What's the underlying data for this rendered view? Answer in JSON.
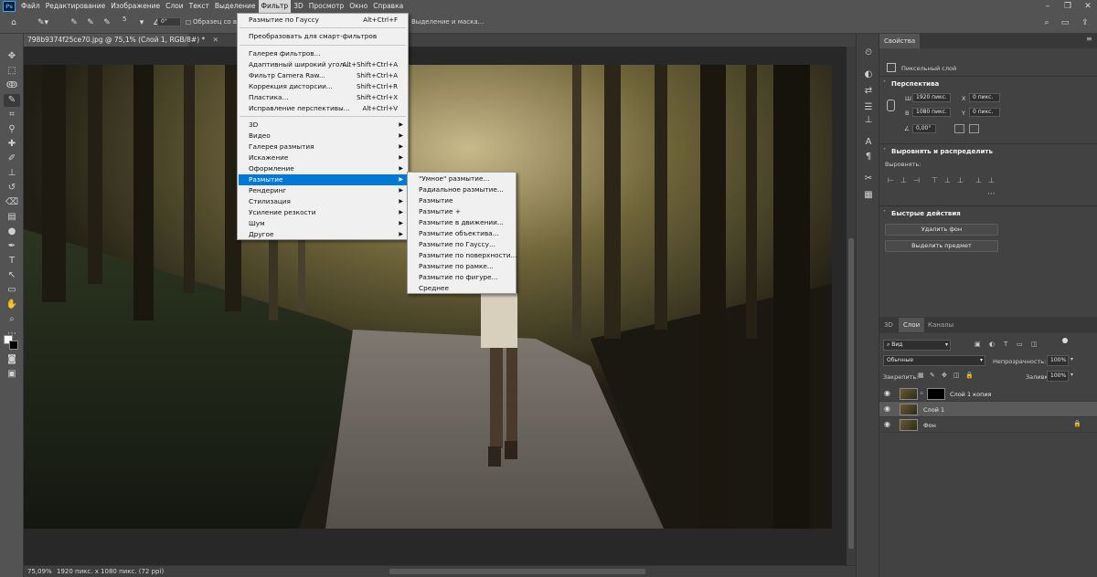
{
  "menubar": {
    "items": [
      "Файл",
      "Редактирование",
      "Изображение",
      "Слои",
      "Текст",
      "Выделение",
      "Фильтр",
      "3D",
      "Просмотр",
      "Окно",
      "Справка"
    ],
    "active": "Фильтр"
  },
  "options_bar": {
    "brush_size": "5",
    "angle": "0°",
    "sample_all_label": "Образец со всех",
    "refine_edge_label": "Выделение и маска..."
  },
  "document": {
    "tab_title": "798b9374f25ce70.jpg @ 75,1% (Слой 1, RGB/8#) *",
    "zoom": "75,09%",
    "doc_size": "1920 пикс. x 1080 пикс. (72 ppi)"
  },
  "filter_menu": {
    "items": [
      {
        "label": "Размытие по Гауссу",
        "shortcut": "Alt+Ctrl+F"
      },
      {
        "label": "Преобразовать для смарт-фильтров",
        "shortcut": ""
      },
      {
        "label": "Галерея фильтров...",
        "shortcut": ""
      },
      {
        "label": "Адаптивный широкий угол...",
        "shortcut": "Alt+Shift+Ctrl+A"
      },
      {
        "label": "Фильтр Camera Raw...",
        "shortcut": "Shift+Ctrl+A"
      },
      {
        "label": "Коррекция дисторсии...",
        "shortcut": "Shift+Ctrl+R"
      },
      {
        "label": "Пластика...",
        "shortcut": "Shift+Ctrl+X"
      },
      {
        "label": "Исправление перспективы...",
        "shortcut": "Alt+Ctrl+V"
      },
      {
        "label": "3D",
        "shortcut": ""
      },
      {
        "label": "Видео",
        "shortcut": ""
      },
      {
        "label": "Галерея размытия",
        "shortcut": ""
      },
      {
        "label": "Искажение",
        "shortcut": ""
      },
      {
        "label": "Оформление",
        "shortcut": ""
      },
      {
        "label": "Размытие",
        "shortcut": ""
      },
      {
        "label": "Рендеринг",
        "shortcut": ""
      },
      {
        "label": "Стилизация",
        "shortcut": ""
      },
      {
        "label": "Усиление резкости",
        "shortcut": ""
      },
      {
        "label": "Шум",
        "shortcut": ""
      },
      {
        "label": "Другое",
        "shortcut": ""
      }
    ],
    "highlighted": "Размытие"
  },
  "blur_submenu": {
    "items": [
      "\"Умное\" размытие...",
      "Радиальное размытие...",
      "Размытие",
      "Размытие +",
      "Размытие в движении...",
      "Размытие объектива...",
      "Размытие по Гауссу...",
      "Размытие по поверхности...",
      "Размытие по рамке...",
      "Размытие по фигуре...",
      "Среднее"
    ]
  },
  "properties": {
    "tab": "Свойства",
    "layer_type": "Пиксельный слой",
    "perspective_title": "Перспектива",
    "w_label": "Ш",
    "w_value": "1920 пикс.",
    "h_label": "В",
    "h_value": "1080 пикс.",
    "x_label": "X",
    "x_value": "0 пикс.",
    "y_label": "Y",
    "y_value": "0 пикс.",
    "angle_value": "0,00°",
    "align_title": "Выровнять и распределить",
    "align_label": "Выровнять:",
    "quick_title": "Быстрые действия",
    "remove_bg": "Удалить фон",
    "select_subject": "Выделить предмет"
  },
  "layers_panel": {
    "tabs": [
      "3D",
      "Слои",
      "Каналы"
    ],
    "active_tab": "Слои",
    "filter_kind": "Вид",
    "blend_mode": "Обычные",
    "opacity_label": "Непрозрачность:",
    "opacity_value": "100%",
    "lock_label": "Закрепить:",
    "fill_label": "Заливка:",
    "fill_value": "100%",
    "layers": [
      {
        "name": "Слой 1 копия",
        "selected": false
      },
      {
        "name": "Слой 1",
        "selected": true
      },
      {
        "name": "Фон",
        "selected": false
      }
    ]
  },
  "colors": {
    "accent": "#0078d7",
    "ps_blue": "#31a8ff"
  }
}
